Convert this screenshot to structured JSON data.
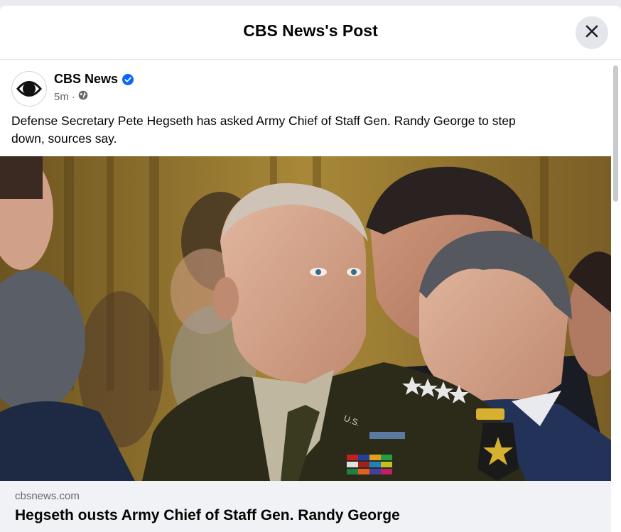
{
  "modal": {
    "title": "CBS News's Post"
  },
  "post": {
    "page_name": "CBS News",
    "verified": true,
    "time": "5m",
    "privacy_icon": "globe-icon",
    "text": "Defense Secretary Pete Hegseth has asked Army Chief of Staff Gen. Randy George to step down, sources say."
  },
  "link_preview": {
    "domain": "cbsnews.com",
    "title": "Hegseth ousts Army Chief of Staff Gen. Randy George"
  },
  "colors": {
    "accent": "#0866ff",
    "text_primary": "#050505",
    "text_secondary": "#65676b",
    "preview_bg": "#f0f2f5"
  }
}
